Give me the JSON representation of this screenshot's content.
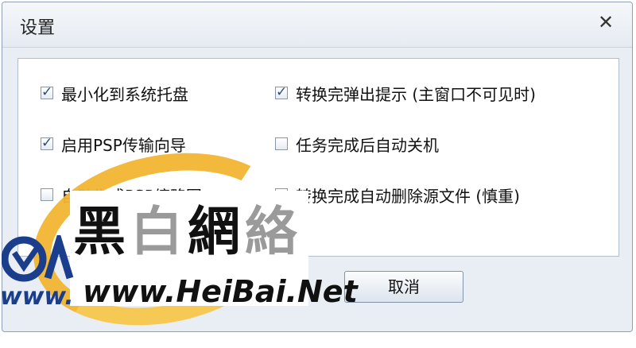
{
  "window": {
    "title": "设置",
    "close_glyph": "✕"
  },
  "options": [
    {
      "label": "最小化到系统托盘",
      "checked": true
    },
    {
      "label": "转换完弹出提示 (主窗口不可见时)",
      "checked": true
    },
    {
      "label": "启用PSP传输向导",
      "checked": true
    },
    {
      "label": "任务完成后自动关机",
      "checked": false
    },
    {
      "label": "自动生成PSP缩略图",
      "checked": false
    },
    {
      "label": "转换完成自动删除源文件 (慎重)",
      "checked": false
    }
  ],
  "buttons": {
    "cancel": "取消"
  },
  "watermark": {
    "chars": [
      "黑",
      "白",
      "網",
      "絡"
    ],
    "www": "www.",
    "url": "www.HeiBai.Net",
    "colors": {
      "gold": "#f2b632",
      "blue": "#1a3e8c"
    }
  }
}
